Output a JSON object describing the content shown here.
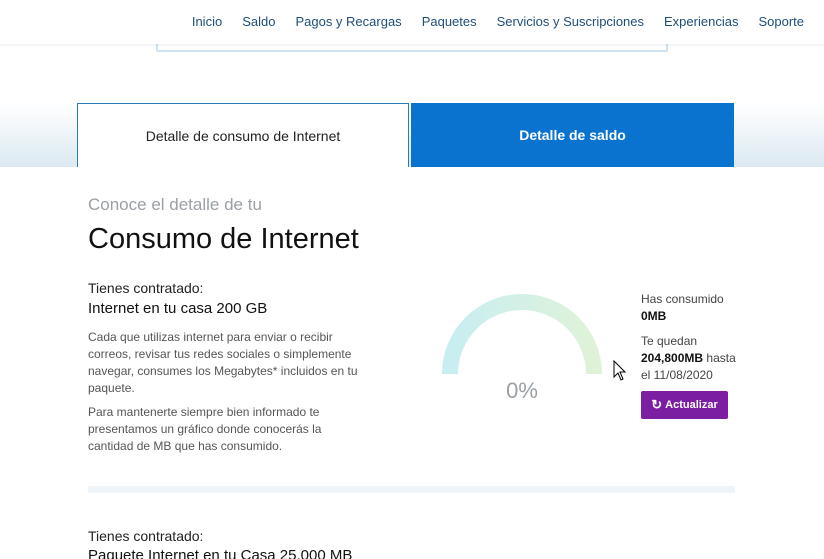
{
  "nav": {
    "items": [
      "Inicio",
      "Saldo",
      "Pagos y Recargas",
      "Paquetes",
      "Servicios y Suscripciones",
      "Experiencias",
      "Soporte"
    ]
  },
  "tabs": {
    "internet": "Detalle de consumo de Internet",
    "saldo": "Detalle de saldo"
  },
  "header": {
    "subtitle": "Conoce el detalle de tu",
    "title": "Consumo de Internet"
  },
  "plan1": {
    "label": "Tienes contratado:",
    "name": "Internet en tu casa 200 GB",
    "desc1": "Cada que utilizas internet para enviar o recibir correos, revisar tus redes sociales o simplemente navegar, consumes los Megabytes* incluidos en tu paquete.",
    "desc2": "Para mantenerte siempre bien informado te presentamos un gráfico donde conocerás la cantidad de MB que has consumido."
  },
  "gauge": {
    "percent_text": "0%",
    "percent_value": 0
  },
  "stats": {
    "consumed_label": "Has consumido",
    "consumed_value": "0MB",
    "remaining_label": "Te quedan",
    "remaining_value": "204,800MB",
    "remaining_suffix": "hasta",
    "until_date": "el 11/08/2020"
  },
  "update_button": {
    "icon": "refresh-icon",
    "label": "Actualizar"
  },
  "plan2": {
    "label": "Tienes contratado:",
    "name": "Paquete Internet en tu Casa 25,000 MB"
  },
  "colors": {
    "tab_active": "#0a73cf",
    "button": "#7b1ea2",
    "nav_link": "#1f4e79"
  }
}
